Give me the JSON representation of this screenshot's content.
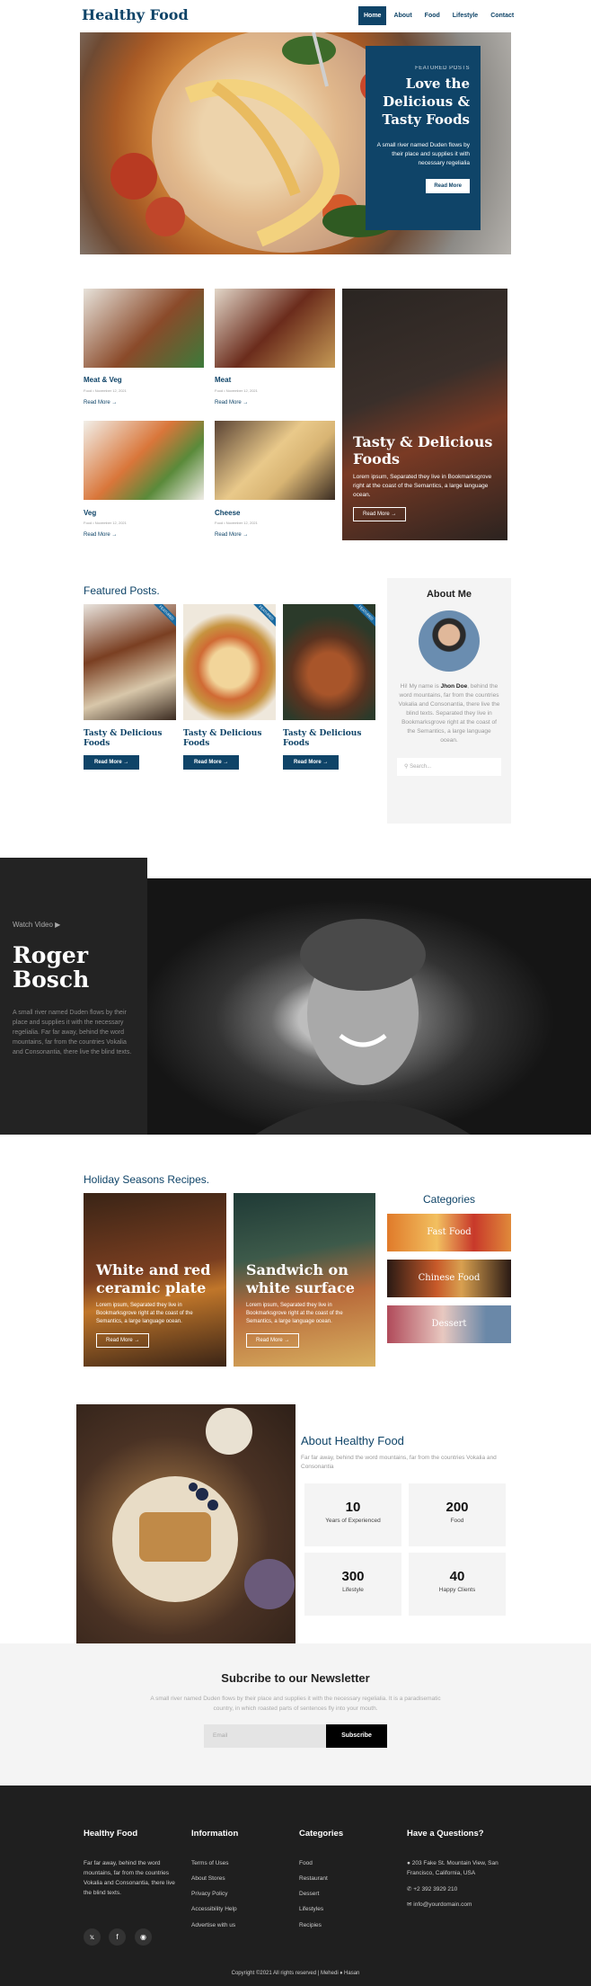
{
  "header": {
    "logo": "Healthy Food",
    "nav": [
      "Home",
      "About",
      "Food",
      "Lifestyle",
      "Contact"
    ]
  },
  "hero": {
    "kicker": "FEATURED POSTS",
    "title": "Love the Delicious & Tasty Foods",
    "text": "A small river named Duden flows by their place and supplies it with necessary regelialia",
    "button": "Read More"
  },
  "cards": [
    {
      "title": "Meat & Veg",
      "meta": "Food • November 12, 2021",
      "link": "Read More →"
    },
    {
      "title": "Meat",
      "meta": "Food • November 12, 2021",
      "link": "Read More →"
    },
    {
      "title": "Veg",
      "meta": "Food • November 12, 2021",
      "link": "Read More →"
    },
    {
      "title": "Cheese",
      "meta": "Food • November 12, 2021",
      "link": "Read More →"
    }
  ],
  "big_card": {
    "title": "Tasty & Delicious Foods",
    "text": "Lorem ipsum, Separated they live in Bookmarksgrove right at the coast of the Semantics, a large language ocean.",
    "button": "Read More →"
  },
  "featured": {
    "heading": "Featured Posts.",
    "badge": "FEATURED",
    "posts": [
      {
        "title": "Tasty & Delicious Foods",
        "button": "Read More →"
      },
      {
        "title": "Tasty & Delicious Foods",
        "button": "Read More →"
      },
      {
        "title": "Tasty & Delicious Foods",
        "button": "Read More →"
      }
    ]
  },
  "about_me": {
    "heading": "About Me",
    "text_pre": "Hi! My name is ",
    "name": "Jhon Doe",
    "text_post": ", behind the word mountains, far from the countries Vokalia and Consonantia, there live the blind texts. Separated they live in Bookmarksgrove right at the coast of the Semantics, a large language ocean.",
    "search_placeholder": "Search..."
  },
  "video": {
    "watch": "Watch Video",
    "name": "Roger Bosch",
    "text": "A small river named Duden flows by their place and supplies it with the necessary regelialia. Far far away, behind the word mountains, far from the countries Vokalia and Consonantia, there live the blind texts."
  },
  "holiday": {
    "heading": "Holiday Seasons Recipes.",
    "recipes": [
      {
        "title": "White and red ceramic plate",
        "text": "Lorem ipsum, Separated they live in Bookmarksgrove right at the coast of the Semantics, a large language ocean.",
        "button": "Read More →"
      },
      {
        "title": "Sandwich on white surface",
        "text": "Lorem ipsum, Separated they live in Bookmarksgrove right at the coast of the Semantics, a large language ocean.",
        "button": "Read More →"
      }
    ],
    "categories_heading": "Categories",
    "categories": [
      "Fast Food",
      "Chinese Food",
      "Dessert"
    ]
  },
  "about_food": {
    "heading": "About Healthy Food",
    "text": "Far far away, behind the word mountains, far from the countries Vokalia and Consonantia",
    "stats": [
      {
        "n": "10",
        "l": "Years of Experienced"
      },
      {
        "n": "200",
        "l": "Food"
      },
      {
        "n": "300",
        "l": "Lifestyle"
      },
      {
        "n": "40",
        "l": "Happy Clients"
      }
    ]
  },
  "newsletter": {
    "heading": "Subcribe to our Newsletter",
    "text": "A small river named Duden flows by their place and supplies it with the necessary regelialia. It is a paradisematic country, in which roasted parts of sentences fly into your mouth.",
    "placeholder": "Email",
    "button": "Subscribe"
  },
  "footer": {
    "col1": {
      "h": "Healthy Food",
      "t": "Far far away, behind the word mountains, far from the countries Vokalia and Consonantia, there live the blind texts."
    },
    "col2": {
      "h": "Information",
      "items": [
        "Terms of Uses",
        "About Stores",
        "Privacy Policy",
        "Accessibility Help",
        "Advertise with us"
      ]
    },
    "col3": {
      "h": "Categories",
      "items": [
        "Food",
        "Restaurant",
        "Dessert",
        "Lifestyles",
        "Recipies"
      ]
    },
    "col4": {
      "h": "Have a Questions?",
      "address": "203 Fake St. Mountain View, San Francisco, California, USA",
      "phone": "+2 392 3929 210",
      "email": "info@yourdomain.com"
    },
    "copyright": "Copyright ©2021 All rights reserved | Mehedi ♦ Hasan"
  },
  "colors": {
    "brand": "#0f4468",
    "dark": "#1f1f1f",
    "light_bg": "#f4f4f4"
  }
}
